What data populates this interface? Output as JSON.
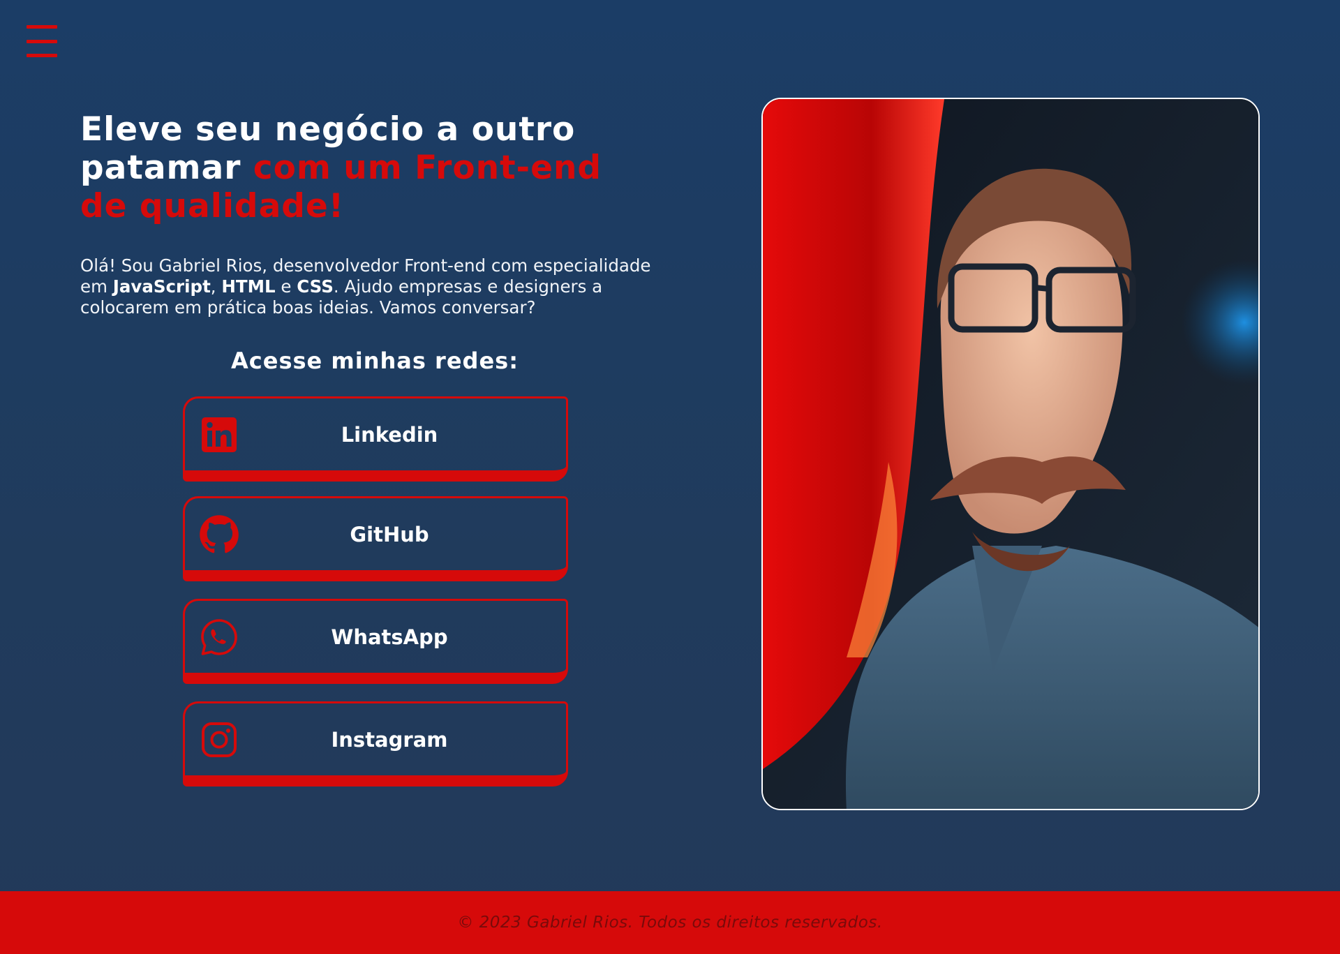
{
  "menu": {
    "icon": "hamburger-menu-icon"
  },
  "hero": {
    "title_line1": "Eleve seu negócio a outro",
    "title_line2_white": "patamar ",
    "title_line2_red": "com um Front-end",
    "title_line3_red": "de qualidade!",
    "intro_1": "Olá! Sou Gabriel Rios, desenvolvedor Front-end com especialidade",
    "intro_2": "em ",
    "intro_js": "JavaScript",
    "intro_comma": ", ",
    "intro_html": "HTML",
    "intro_e": " e ",
    "intro_css": "CSS",
    "intro_3": ". Ajudo empresas e designers a",
    "intro_4": "colocarem em prática boas ideias. Vamos conversar?"
  },
  "networks": {
    "title": "Acesse minhas redes:",
    "items": [
      {
        "label": "Linkedin",
        "icon": "linkedin-icon"
      },
      {
        "label": "GitHub",
        "icon": "github-icon"
      },
      {
        "label": "WhatsApp",
        "icon": "whatsapp-icon"
      },
      {
        "label": "Instagram",
        "icon": "instagram-icon"
      }
    ]
  },
  "footer": {
    "text": "© 2023 Gabriel Rios. Todos os direitos reservados."
  },
  "colors": {
    "accent": "#d60a0a",
    "background": "#1b3d66",
    "text": "#ffffff"
  }
}
